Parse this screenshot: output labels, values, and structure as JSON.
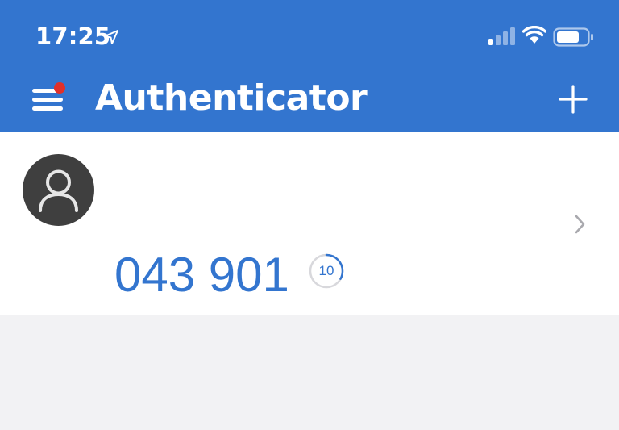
{
  "status_bar": {
    "time": "17:25",
    "location_icon": "location-arrow-icon",
    "signal_icon": "cellular-signal-icon",
    "wifi_icon": "wifi-icon",
    "battery_icon": "battery-icon"
  },
  "header": {
    "title": "Authenticator",
    "menu_icon": "hamburger-menu-icon",
    "menu_has_notification": true,
    "add_icon": "plus-icon"
  },
  "accounts": [
    {
      "avatar_icon": "user-icon",
      "code": "043 901",
      "seconds_remaining": "10",
      "timer_progress": 0.33,
      "chevron_icon": "chevron-right-icon"
    }
  ],
  "colors": {
    "brand": "#3375cf",
    "notification_dot": "#e0302a",
    "background": "#f2f2f4",
    "avatar": "#3f3f3f"
  }
}
